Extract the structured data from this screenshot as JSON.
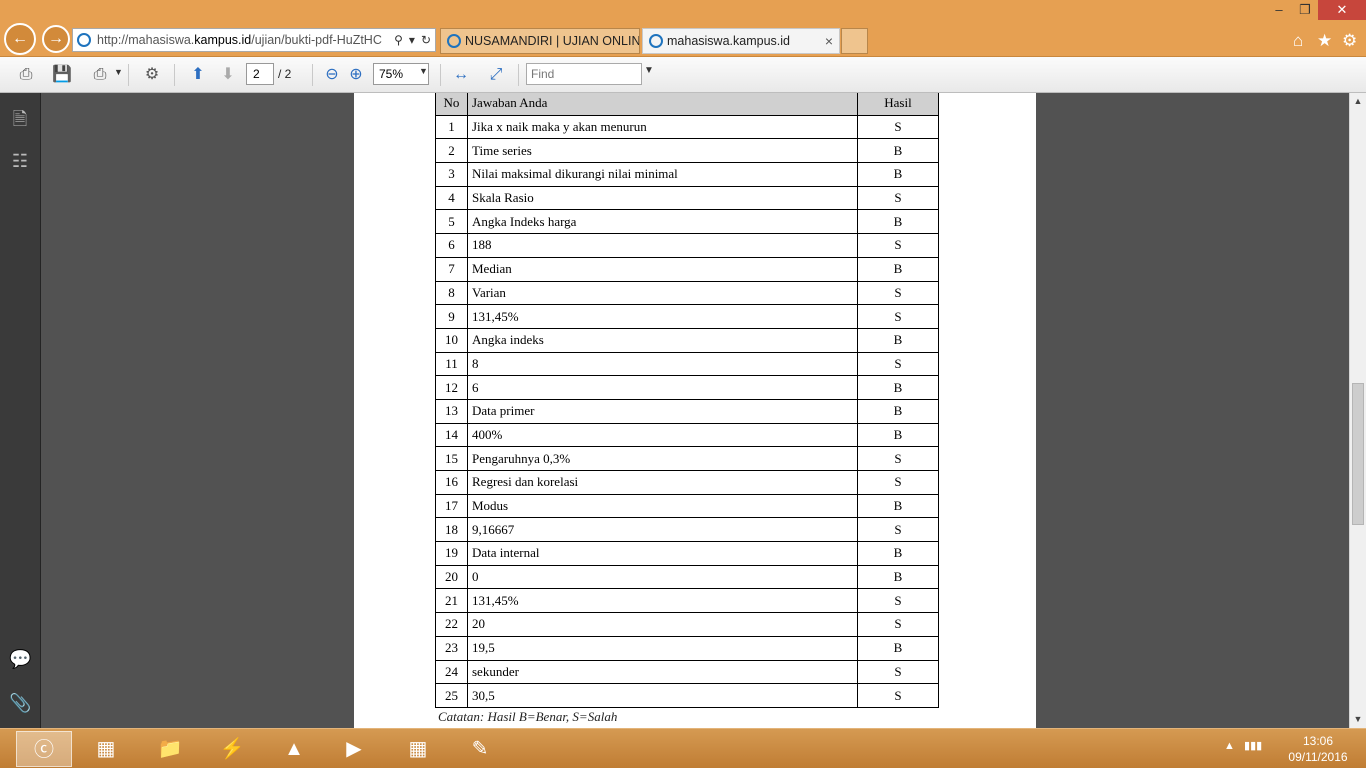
{
  "browser": {
    "address_url_main": "http://mahasiswa.",
    "address_url_host": "kampus.id",
    "address_url_rest": "/ujian/bukti-pdf-HuZtHC",
    "tabs": [
      {
        "label": "NUSAMANDIRI | UJIAN ONLINE"
      },
      {
        "label": "mahasiswa.kampus.id"
      }
    ]
  },
  "pdf_toolbar": {
    "current_page": "2",
    "total_pages": "/ 2",
    "zoom": "75%",
    "find_placeholder": "Find"
  },
  "table": {
    "headers": {
      "no": "No",
      "answer": "Jawaban Anda",
      "result": "Hasil"
    },
    "rows": [
      {
        "no": "1",
        "answer": "Jika x naik maka y akan menurun",
        "result": "S"
      },
      {
        "no": "2",
        "answer": "Time series",
        "result": "B"
      },
      {
        "no": "3",
        "answer": "Nilai maksimal dikurangi nilai minimal",
        "result": "B"
      },
      {
        "no": "4",
        "answer": "Skala Rasio",
        "result": "S"
      },
      {
        "no": "5",
        "answer": "Angka Indeks harga",
        "result": "B"
      },
      {
        "no": "6",
        "answer": "188",
        "result": "S"
      },
      {
        "no": "7",
        "answer": "Median",
        "result": "B"
      },
      {
        "no": "8",
        "answer": "Varian",
        "result": "S"
      },
      {
        "no": "9",
        "answer": "131,45%",
        "result": "S"
      },
      {
        "no": "10",
        "answer": "Angka indeks",
        "result": "B"
      },
      {
        "no": "11",
        "answer": "8",
        "result": "S"
      },
      {
        "no": "12",
        "answer": "6",
        "result": "B"
      },
      {
        "no": "13",
        "answer": "Data primer",
        "result": "B"
      },
      {
        "no": "14",
        "answer": "400%",
        "result": "B"
      },
      {
        "no": "15",
        "answer": "Pengaruhnya 0,3%",
        "result": "S"
      },
      {
        "no": "16",
        "answer": "Regresi dan korelasi",
        "result": "S"
      },
      {
        "no": "17",
        "answer": "Modus",
        "result": "B"
      },
      {
        "no": "18",
        "answer": "9,16667",
        "result": "S"
      },
      {
        "no": "19",
        "answer": "Data internal",
        "result": "B"
      },
      {
        "no": "20",
        "answer": "0",
        "result": "B"
      },
      {
        "no": "21",
        "answer": "131,45%",
        "result": "S"
      },
      {
        "no": "22",
        "answer": "20",
        "result": "S"
      },
      {
        "no": "23",
        "answer": "19,5",
        "result": "B"
      },
      {
        "no": "24",
        "answer": "sekunder",
        "result": "S"
      },
      {
        "no": "25",
        "answer": "30,5",
        "result": "S"
      }
    ],
    "note": "Catatan: Hasil B=Benar, S=Salah"
  },
  "taskbar": {
    "apps": [
      "internet-explorer-icon",
      "firewall-icon",
      "file-explorer-icon",
      "winamp-icon",
      "vlc-icon",
      "media-player-icon",
      "calculator-icon",
      "notepad-icon"
    ],
    "time": "13:06",
    "date": "09/11/2016"
  }
}
